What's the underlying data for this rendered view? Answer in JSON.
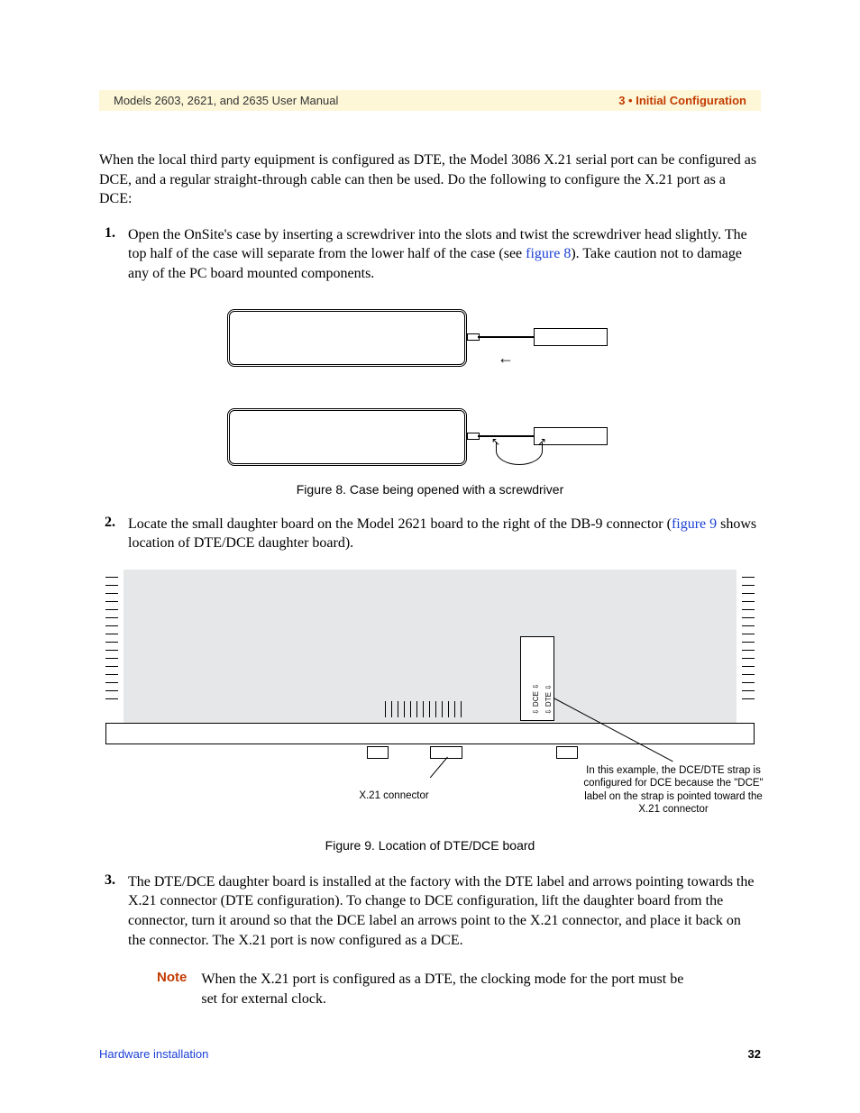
{
  "header": {
    "left": "Models 2603, 2621, and 2635 User Manual",
    "right": "3 • Initial Configuration"
  },
  "intro": "When the local third party equipment is configured as DTE, the Model 3086 X.21 serial port can be configured as DCE, and a regular straight-through cable can then be used. Do the following to configure the X.21 port as a DCE:",
  "steps": [
    {
      "num": "1.",
      "before": "Open the OnSite's case by inserting a screwdriver into the slots and twist the screwdriver head slightly. The top half of the case will separate from the lower half of the case (see ",
      "link": "figure 8",
      "after": "). Take caution not to damage any of the PC board mounted components."
    },
    {
      "num": "2.",
      "before": "Locate the small daughter board on the Model 2621 board to the right of the DB-9 connector (",
      "link": "figure 9",
      "after": " shows location of DTE/DCE daughter board)."
    },
    {
      "num": "3.",
      "before": "The DTE/DCE daughter board is installed at the factory with the DTE label and arrows pointing towards the X.21 connector (DTE configuration). To change to DCE configuration, lift the daughter board from the connector, turn it around so that the DCE label an arrows point to the X.21 connector, and place it back on the connector. The X.21 port is now configured as a DCE.",
      "link": "",
      "after": ""
    }
  ],
  "figure8_caption": "Figure 8. Case being opened with a screwdriver",
  "figure9_caption": "Figure 9. Location of DTE/DCE board",
  "fig9": {
    "x21_label": "X.21 connector",
    "annotation": "In this example, the DCE/DTE strap is configured for DCE because the \"DCE\" label on the strap is pointed toward the X.21 connector",
    "dce": "⇩  DCE  ⇩",
    "dte": "⇩  DTE  ⇩"
  },
  "note": {
    "label": "Note",
    "text": "When the X.21 port is configured as a DTE, the clocking mode for the port must be set for external clock."
  },
  "footer": {
    "left": "Hardware installation",
    "right": "32"
  }
}
